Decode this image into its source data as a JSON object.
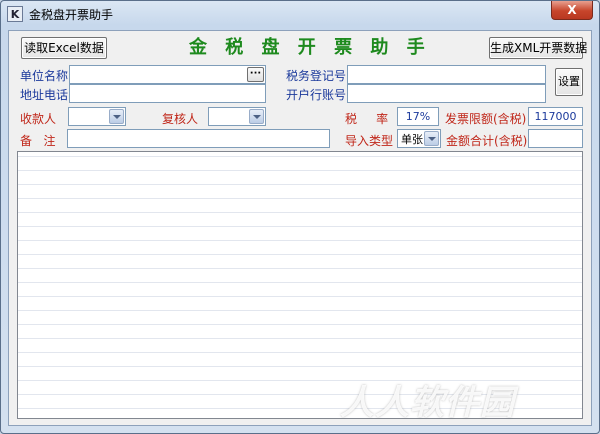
{
  "window": {
    "title": "金税盘开票助手",
    "icon_letter": "K",
    "close_label": "X"
  },
  "toolbar": {
    "read_excel_label": "读取Excel数据",
    "headline": "金 税 盘 开 票 助 手",
    "gen_xml_label": "生成XML开票数据",
    "settings_label": "设置"
  },
  "form": {
    "company_name_label": "单位名称",
    "company_name_value": "",
    "company_name_browse": "···",
    "address_phone_label": "地址电话",
    "address_phone_value": "",
    "tax_reg_label": "税务登记号",
    "tax_reg_value": "",
    "bank_account_label": "开户行账号",
    "bank_account_value": "",
    "payee_label": "收款人",
    "payee_value": "",
    "reviewer_label": "复核人",
    "reviewer_value": "",
    "tax_rate_label": "税     率",
    "tax_rate_value": "17%",
    "invoice_limit_label": "发票限额(含税)",
    "invoice_limit_value": "117000",
    "remark_label": "备   注",
    "remark_value": "",
    "import_type_label": "导入类型",
    "import_type_value": "单张",
    "total_amount_label": "金额合计(含税)",
    "total_amount_value": ""
  },
  "watermark": "人人软件园",
  "colors": {
    "label_blue": "#1c3a9c",
    "label_red": "#c0271a",
    "headline_green": "#1e8a1e",
    "close_red": "#c7452b"
  }
}
